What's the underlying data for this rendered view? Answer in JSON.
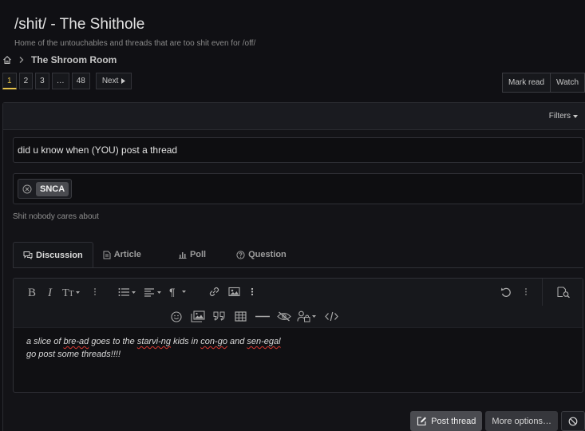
{
  "forum": {
    "title": "/shit/ - The Shithole",
    "description": "Home of the untouchables and threads that are too shit even for /off/"
  },
  "breadcrumb": {
    "home_icon": "home-icon",
    "current": "The Shroom Room"
  },
  "pagination": {
    "pages": [
      "1",
      "2",
      "3",
      "…",
      "48"
    ],
    "current": "1",
    "next_label": "Next"
  },
  "top_actions": {
    "mark_read": "Mark read",
    "watch": "Watch"
  },
  "filters_label": "Filters",
  "thread_form": {
    "title_value": "did u know when (YOU)  post a thread",
    "prefix_label": "SNCA",
    "prefix_hint": "Shit nobody cares about",
    "tabs": [
      {
        "label": "Discussion",
        "icon": "comments-icon",
        "active": true
      },
      {
        "label": "Article",
        "icon": "article-icon",
        "active": false
      },
      {
        "label": "Poll",
        "icon": "poll-icon",
        "active": false
      },
      {
        "label": "Question",
        "icon": "question-icon",
        "active": false
      }
    ],
    "body_line1_parts": [
      "a slice of ",
      "bre-ad",
      " goes to the ",
      "starvi-ng",
      " kids in ",
      "con-go",
      " and ",
      "sen-egal"
    ],
    "body_line2": "go post some threads!!!!",
    "post_button": "Post thread",
    "more_options": "More options…"
  },
  "colors": {
    "background": "#101014",
    "accent_page": "#e6c34a",
    "spellcheck": "#d9362f"
  }
}
